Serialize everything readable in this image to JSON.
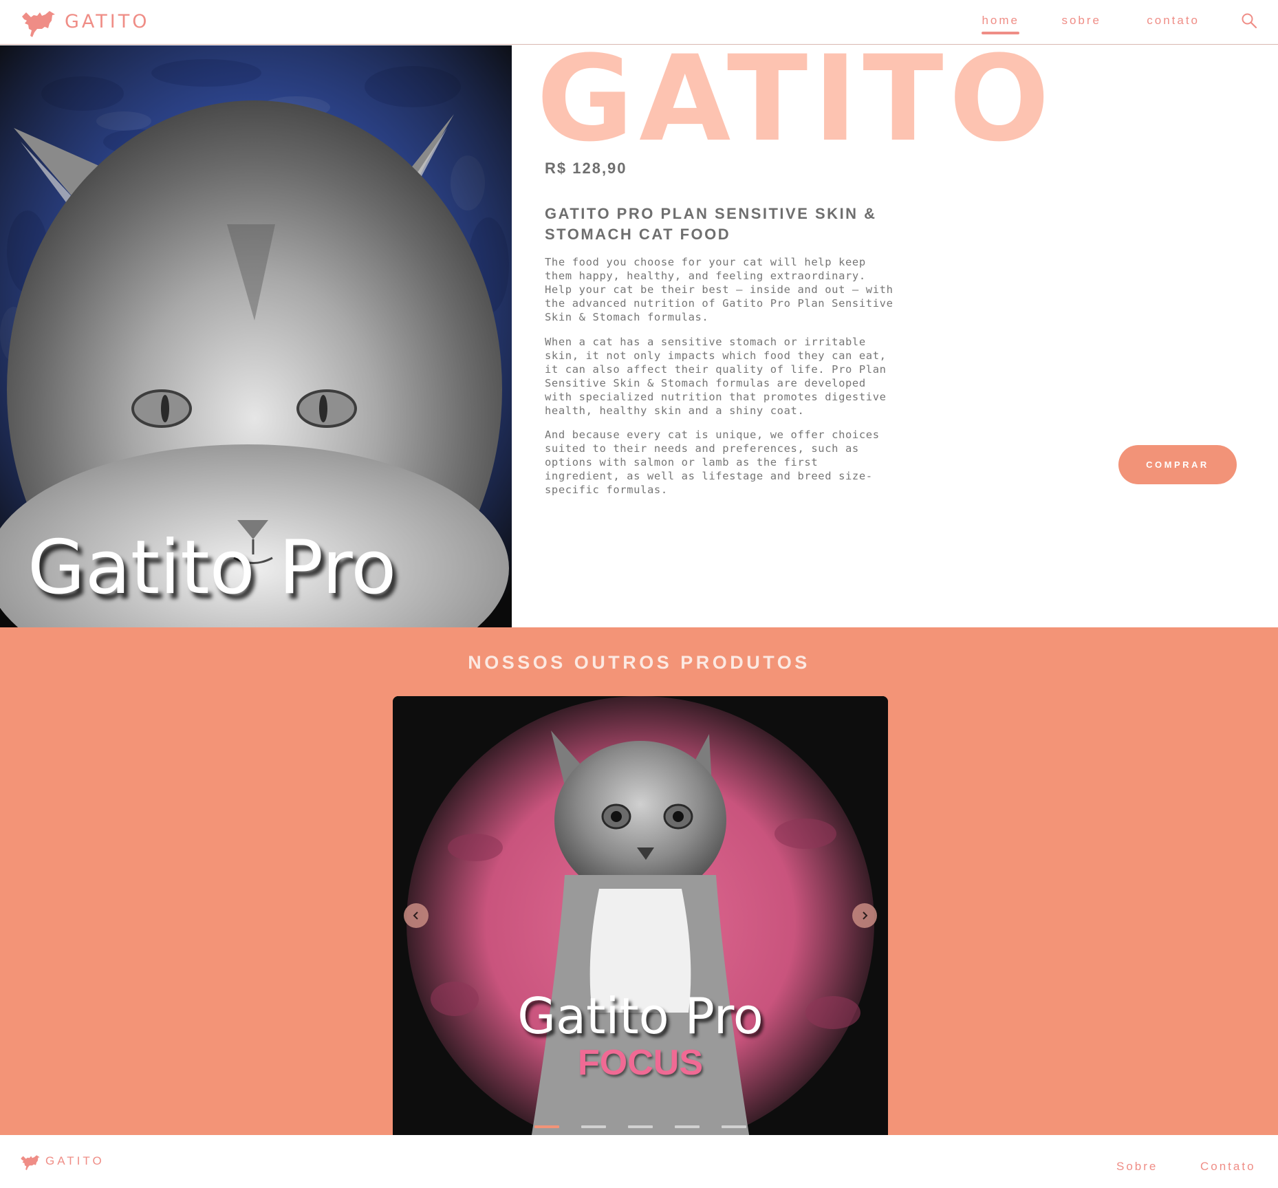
{
  "header": {
    "logo_text": "GATITO",
    "nav": [
      {
        "label": "home",
        "active": true
      },
      {
        "label": "sobre",
        "active": false
      },
      {
        "label": "contato",
        "active": false
      }
    ],
    "search_icon": "search-icon"
  },
  "product": {
    "image_caption": "Gatito Pro",
    "big_title": "GATITO",
    "price": "R$ 128,90",
    "name": "GATITO PRO PLAN SENSITIVE SKIN & STOMACH CAT FOOD",
    "description": [
      "The food you choose for your cat will help keep them happy, healthy, and feeling extraordinary. Help your cat be their best – inside and out – with the advanced nutrition of Gatito Pro Plan Sensitive Skin & Stomach formulas.",
      "When a cat has a sensitive stomach or irritable skin, it not only impacts which food they can eat, it can also affect their quality of life. Pro Plan Sensitive Skin & Stomach formulas are developed with specialized nutrition that promotes digestive health, healthy skin and a shiny coat.",
      "And because every cat is unique, we offer choices suited to their needs and preferences, such as options with salmon or lamb as the first ingredient, as well as lifestage and breed size-specific formulas."
    ],
    "buy_label": "COMPRAR"
  },
  "others": {
    "title": "NOSSOS OUTROS PRODUTOS",
    "slide": {
      "caption_line1": "Gatito Pro",
      "caption_line2": "FOCUS"
    },
    "prev_icon": "chevron-left-icon",
    "next_icon": "chevron-right-icon",
    "slide_count": 5,
    "active_slide": 1
  },
  "footer": {
    "logo_text": "GATITO",
    "links": [
      "Sobre",
      "Contato"
    ]
  },
  "colors": {
    "accent": "#f29378",
    "title_peach": "#fdc3b1",
    "section_bg": "#f39477",
    "logo_pink": "#ef8d86",
    "blue_splash": "#3e61c8",
    "pink_splash": "#d65c86"
  }
}
